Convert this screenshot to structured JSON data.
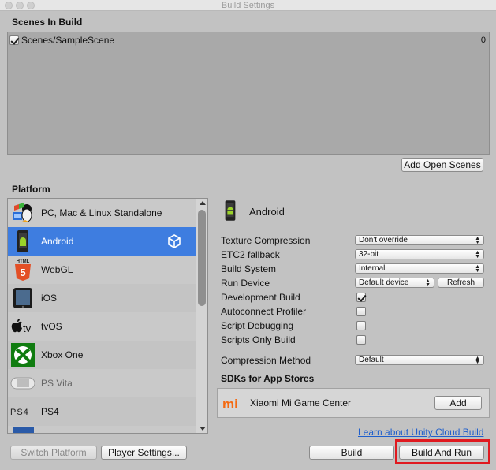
{
  "window": {
    "title": "Build Settings"
  },
  "scenes": {
    "header": "Scenes In Build",
    "items": [
      {
        "path": "Scenes/SampleScene",
        "index": "0",
        "checked": true
      }
    ],
    "add_open_scenes": "Add Open Scenes"
  },
  "platform": {
    "header": "Platform",
    "items": [
      {
        "label": "PC, Mac & Linux Standalone",
        "icon": "pc-mac-linux-icon"
      },
      {
        "label": "Android",
        "icon": "android-icon",
        "selected": true
      },
      {
        "label": "WebGL",
        "icon": "html5-icon"
      },
      {
        "label": "iOS",
        "icon": "ios-device-icon"
      },
      {
        "label": "tvOS",
        "icon": "apple-tv-icon"
      },
      {
        "label": "Xbox One",
        "icon": "xbox-icon"
      },
      {
        "label": "PS Vita",
        "icon": "ps-vita-icon"
      },
      {
        "label": "PS4",
        "icon": "ps4-icon"
      }
    ],
    "logos": {
      "tvos": "tv",
      "webgl": "HTML",
      "ps4": "PS4",
      "xiaomi": "mi"
    }
  },
  "settings": {
    "platform_name": "Android",
    "texture_compression": {
      "label": "Texture Compression",
      "value": "Don't override"
    },
    "etc2_fallback": {
      "label": "ETC2 fallback",
      "value": "32-bit"
    },
    "build_system": {
      "label": "Build System",
      "value": "Internal"
    },
    "run_device": {
      "label": "Run Device",
      "value": "Default device",
      "refresh": "Refresh"
    },
    "development_build": {
      "label": "Development Build",
      "checked": true
    },
    "autoconnect_profiler": {
      "label": "Autoconnect Profiler",
      "checked": false
    },
    "script_debugging": {
      "label": "Script Debugging",
      "checked": false
    },
    "scripts_only_build": {
      "label": "Scripts Only Build",
      "checked": false
    },
    "compression_method": {
      "label": "Compression Method",
      "value": "Default"
    }
  },
  "sdks": {
    "header": "SDKs for App Stores",
    "items": [
      {
        "name": "Xiaomi Mi Game Center",
        "action": "Add"
      }
    ]
  },
  "cloud_link": "Learn about Unity Cloud Build",
  "buttons": {
    "switch_platform": "Switch Platform",
    "player_settings": "Player Settings...",
    "build": "Build",
    "build_and_run": "Build And Run"
  },
  "colors": {
    "selected": "#3e7de0",
    "highlight": "#e0191f",
    "link": "#1f5fcc"
  }
}
